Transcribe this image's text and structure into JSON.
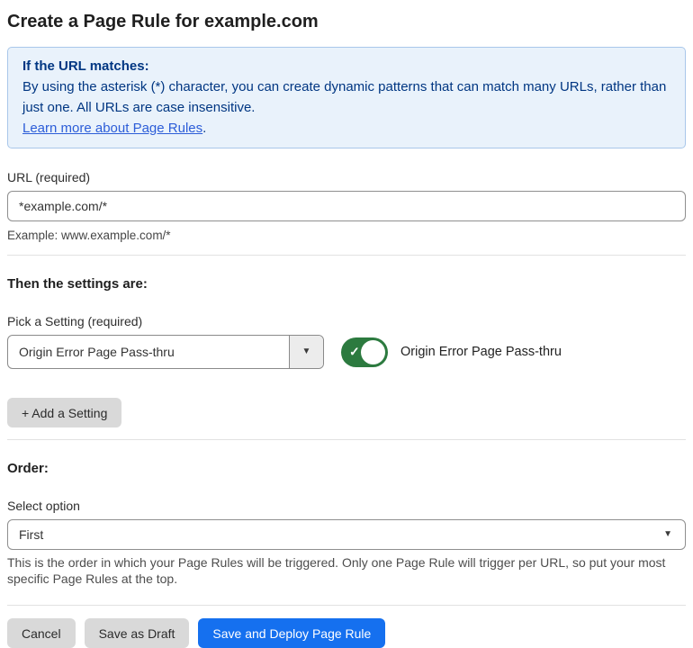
{
  "page": {
    "title": "Create a Page Rule for example.com"
  },
  "info_box": {
    "heading": "If the URL matches:",
    "body": "By using the asterisk (*) character, you can create dynamic patterns that can match many URLs, rather than just one. All URLs are case insensitive.",
    "link": "Learn more about Page Rules",
    "link_suffix": "."
  },
  "url_field": {
    "label": "URL (required)",
    "value": "*example.com/*",
    "helper": "Example: www.example.com/*"
  },
  "settings_section": {
    "heading": "Then the settings are:",
    "picker_label": "Pick a Setting (required)",
    "picker_value": "Origin Error Page Pass-thru",
    "toggle_state": "on",
    "toggle_label": "Origin Error Page Pass-thru",
    "add_setting_button": "+ Add a Setting"
  },
  "order_section": {
    "heading": "Order:",
    "select_label": "Select option",
    "select_value": "First",
    "helper": "This is the order in which your Page Rules will be triggered. Only one Page Rule will trigger per URL, so put your most specific Page Rules at the top."
  },
  "footer": {
    "cancel_button": "Cancel",
    "save_draft_button": "Save as Draft",
    "save_deploy_button": "Save and Deploy Page Rule"
  },
  "icons": {
    "dropdown_arrow": "▼",
    "check": "✓"
  },
  "colors": {
    "info_bg": "#e9f2fb",
    "info_border": "#a9c7ea",
    "info_text": "#003682",
    "link_blue": "#2c5dd8",
    "toggle_green": "#2c7a3f",
    "primary_blue": "#1570ef",
    "button_gray": "#d9d9d9"
  }
}
